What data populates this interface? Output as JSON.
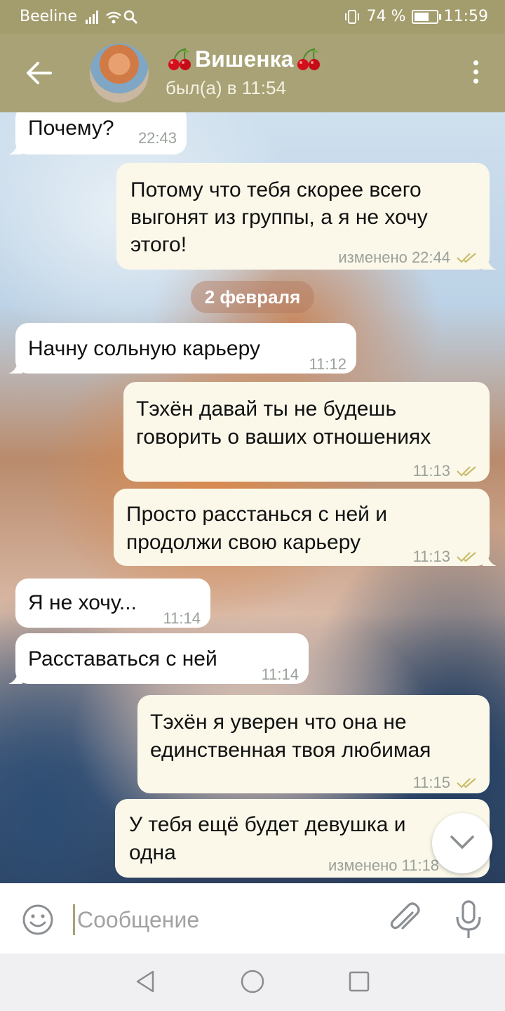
{
  "status_bar": {
    "carrier": "Beeline",
    "battery": "74 %",
    "battery_level": 0.74,
    "time": "11:59"
  },
  "header": {
    "title": "Вишенка",
    "status": "был(а) в 11:54"
  },
  "messages": [
    {
      "dir": "in",
      "text_lines": [
        "Почему?"
      ],
      "time": "22:43"
    },
    {
      "dir": "out",
      "text_lines": [
        "Потому что тебя скорее всего",
        "выгонят из группы, а я не хочу",
        "этого!"
      ],
      "time": "изменено 22:44",
      "read": true
    },
    {
      "dir": "in",
      "text_lines": [
        "Начну сольную карьеру"
      ],
      "time": "11:12"
    },
    {
      "dir": "out",
      "text_lines": [
        "Тэхён давай ты не будешь",
        "говорить о ваших отношениях"
      ],
      "time": "11:13",
      "read": true
    },
    {
      "dir": "out",
      "text_lines": [
        "Просто расстанься с ней и",
        "продолжи свою карьеру"
      ],
      "time": "11:13",
      "read": true
    },
    {
      "dir": "in",
      "text_lines": [
        "Я не хочу..."
      ],
      "time": "11:14"
    },
    {
      "dir": "in",
      "text_lines": [
        "Расставаться с ней"
      ],
      "time": "11:14"
    },
    {
      "dir": "out",
      "text_lines": [
        "Тэхён я уверен что она не",
        "единственная твоя любимая"
      ],
      "time": "11:15",
      "read": true
    },
    {
      "dir": "out",
      "text_lines": [
        "У тебя ещё будет девушка и",
        "одна"
      ],
      "time": "изменено 11:18",
      "read": true
    }
  ],
  "date_separator": "2 февраля",
  "input": {
    "placeholder": "Сообщение",
    "value": ""
  },
  "icons": {
    "back": "arrow-left-icon",
    "menu": "more-vertical-icon",
    "emoji": "smiley-icon",
    "attach": "paperclip-icon",
    "mic": "microphone-icon",
    "scroll": "chevron-down-icon"
  },
  "colors": {
    "header": "#a8a276",
    "status_bar": "#a39d6e",
    "incoming_bubble": "#ffffff",
    "outgoing_bubble": "#fbf8ea",
    "read_ticks": "#c9bd6a"
  }
}
